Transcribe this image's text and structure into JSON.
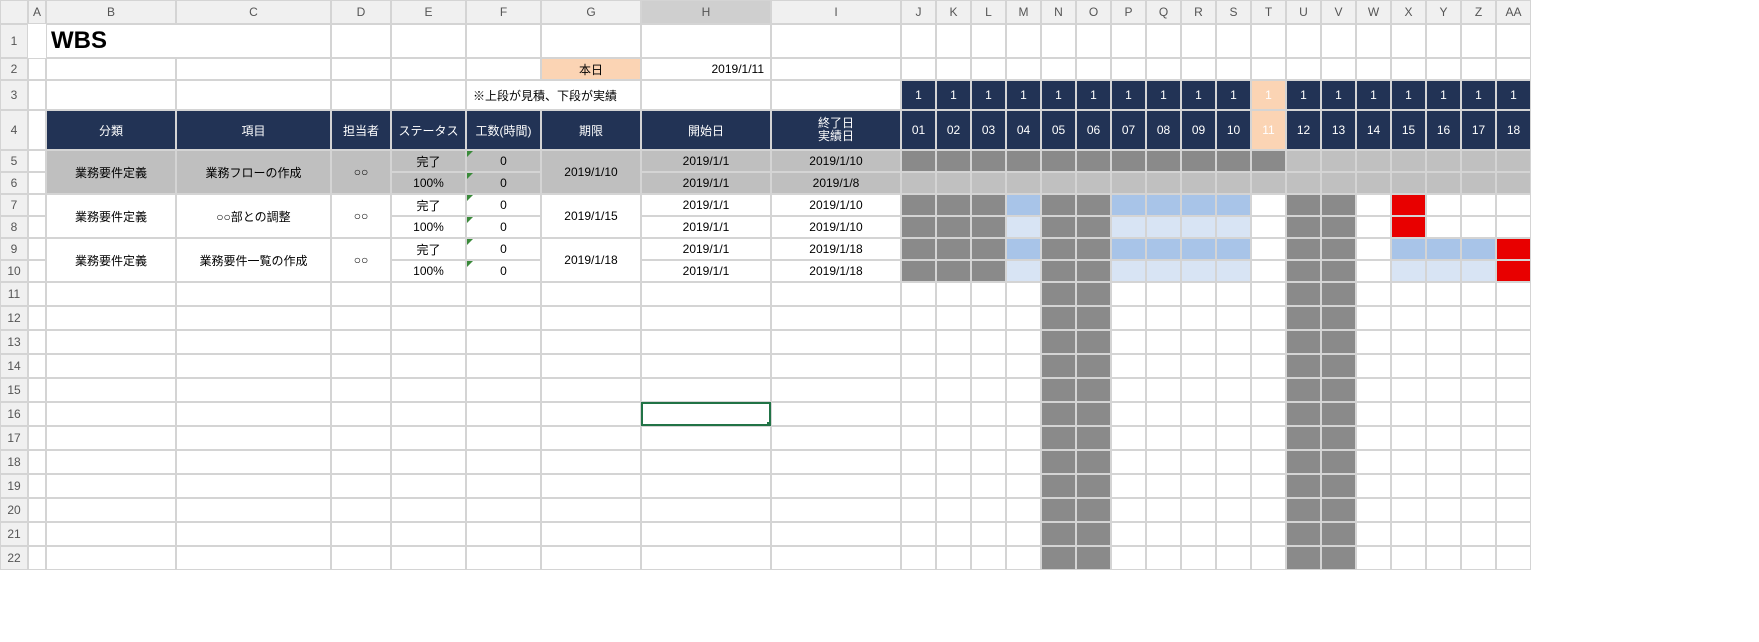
{
  "cols": [
    "A",
    "B",
    "C",
    "D",
    "E",
    "F",
    "G",
    "H",
    "I",
    "J",
    "K",
    "L",
    "M",
    "N",
    "O",
    "P",
    "Q",
    "R",
    "S",
    "T",
    "U",
    "V",
    "W",
    "X",
    "Y",
    "Z",
    "AA"
  ],
  "rows": [
    "1",
    "2",
    "3",
    "4",
    "5",
    "6",
    "7",
    "8",
    "9",
    "10",
    "11",
    "12",
    "13",
    "14",
    "15",
    "16",
    "17",
    "18",
    "19",
    "20",
    "21",
    "22"
  ],
  "title": "WBS",
  "today_label": "本日",
  "today_date": "2019/1/11",
  "note": "※上段が見積、下段が実績",
  "headers": {
    "category": "分類",
    "item": "項目",
    "assignee": "担当者",
    "status": "ステータス",
    "effort": "工数(時間)",
    "deadline": "期限",
    "start": "開始日",
    "end": "終了日\n実績日"
  },
  "months": [
    "1",
    "1",
    "1",
    "1",
    "1",
    "1",
    "1",
    "1",
    "1",
    "1",
    "1",
    "1",
    "1",
    "1",
    "1",
    "1",
    "1",
    "1"
  ],
  "days": [
    "01",
    "02",
    "03",
    "04",
    "05",
    "06",
    "07",
    "08",
    "09",
    "10",
    "11",
    "12",
    "13",
    "14",
    "15",
    "16",
    "17",
    "18"
  ],
  "tasks": [
    {
      "category": "業務要件定義",
      "item": "業務フローの作成",
      "assignee": "○○",
      "est": {
        "status": "完了",
        "effort": "0",
        "deadline": "2019/1/10",
        "start": "2019/1/1",
        "end": "2019/1/10"
      },
      "act": {
        "status": "100%",
        "effort": "0",
        "start": "2019/1/1",
        "end": "2019/1/8"
      }
    },
    {
      "category": "業務要件定義",
      "item": "○○部との調整",
      "assignee": "○○",
      "est": {
        "status": "完了",
        "effort": "0",
        "deadline": "2019/1/15",
        "start": "2019/1/1",
        "end": "2019/1/10"
      },
      "act": {
        "status": "100%",
        "effort": "0",
        "start": "2019/1/1",
        "end": "2019/1/10"
      }
    },
    {
      "category": "業務要件定義",
      "item": "業務要件一覧の作成",
      "assignee": "○○",
      "est": {
        "status": "完了",
        "effort": "0",
        "deadline": "2019/1/18",
        "start": "2019/1/1",
        "end": "2019/1/18"
      },
      "act": {
        "status": "100%",
        "effort": "0",
        "start": "2019/1/1",
        "end": "2019/1/18"
      }
    }
  ],
  "gantt_flags": {
    "weekend_cols": [
      4,
      5,
      11,
      12
    ],
    "today_col": 10,
    "rows": [
      [
        "g",
        "g",
        "g",
        "g",
        "g",
        "g",
        "g",
        "g",
        "g",
        "g",
        "g",
        "lg",
        "lg",
        "lg",
        "lg",
        "lg",
        "lg",
        "lg"
      ],
      [
        "lg",
        "lg",
        "lg",
        "lg",
        "lg",
        "lg",
        "lg",
        "lg",
        "lg",
        "lg",
        "lg",
        "lg",
        "lg",
        "lg",
        "lg",
        "lg",
        "lg",
        "lg"
      ],
      [
        "g",
        "g",
        "g",
        "b",
        "g",
        "g",
        "b",
        "b",
        "b",
        "b",
        "",
        "",
        "",
        "",
        "r",
        "",
        "",
        ""
      ],
      [
        "g",
        "g",
        "g",
        "lb",
        "g",
        "g",
        "lb",
        "lb",
        "lb",
        "lb",
        "",
        "",
        "",
        "",
        "r",
        "",
        "",
        ""
      ],
      [
        "g",
        "g",
        "g",
        "b",
        "g",
        "g",
        "b",
        "b",
        "b",
        "b",
        "",
        "",
        "",
        "",
        "b",
        "b",
        "b",
        "r"
      ],
      [
        "g",
        "g",
        "g",
        "lb",
        "g",
        "g",
        "lb",
        "lb",
        "lb",
        "lb",
        "",
        "",
        "",
        "",
        "lb",
        "lb",
        "lb",
        "r"
      ]
    ]
  }
}
